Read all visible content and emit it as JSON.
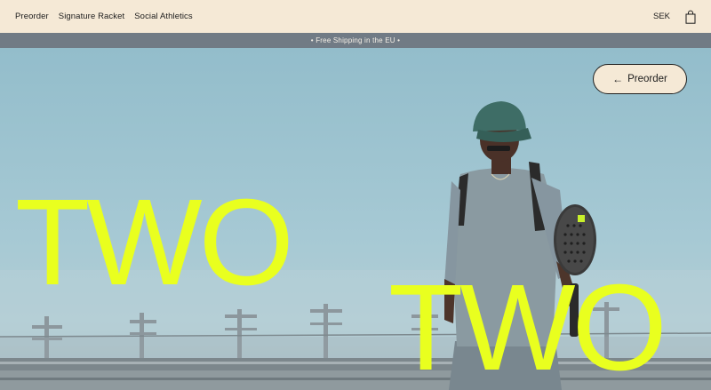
{
  "header": {
    "nav": [
      {
        "label": "Preorder"
      },
      {
        "label": "Signature Racket"
      },
      {
        "label": "Social Athletics"
      }
    ],
    "currency": "SEK",
    "cart_icon": "shopping-bag-icon"
  },
  "announcement": {
    "text": "• Free Shipping in the EU •"
  },
  "hero": {
    "preorder_button": {
      "arrow": "←",
      "label": "Preorder"
    },
    "headline_top": "TWO",
    "headline_bottom": "TWO"
  },
  "colors": {
    "header_bg": "#f5e9d6",
    "announce_bg": "#717b85",
    "accent_yellow": "#e9ff1f",
    "sky": "#9fc3cf"
  }
}
